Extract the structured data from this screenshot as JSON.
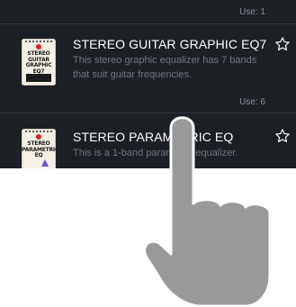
{
  "top_use_label": "Use: 1",
  "effects": [
    {
      "thumbnail_text": [
        "STEREO",
        "GUITAR",
        "GRAPHIC EQ7"
      ],
      "title": "STEREO GUITAR GRAPHIC EQ7",
      "description": "This stereo graphic equalizer has 7 bands that suit guitar frequencies.",
      "use_label": "Use: 6"
    },
    {
      "thumbnail_text": [
        "STEREO",
        "PARAMETRIC",
        "EQ"
      ],
      "title": "STEREO PARAMETRIC EQ",
      "description": "This is a 1-band parametric equalizer."
    }
  ],
  "colors": {
    "panel_background": "#1c1f24",
    "title_text": "#ffffff",
    "description_text": "#6f7680",
    "hand": "#999999"
  },
  "icons": {
    "favorite": "star-outline-icon",
    "gesture": "pointing-hand-icon"
  }
}
